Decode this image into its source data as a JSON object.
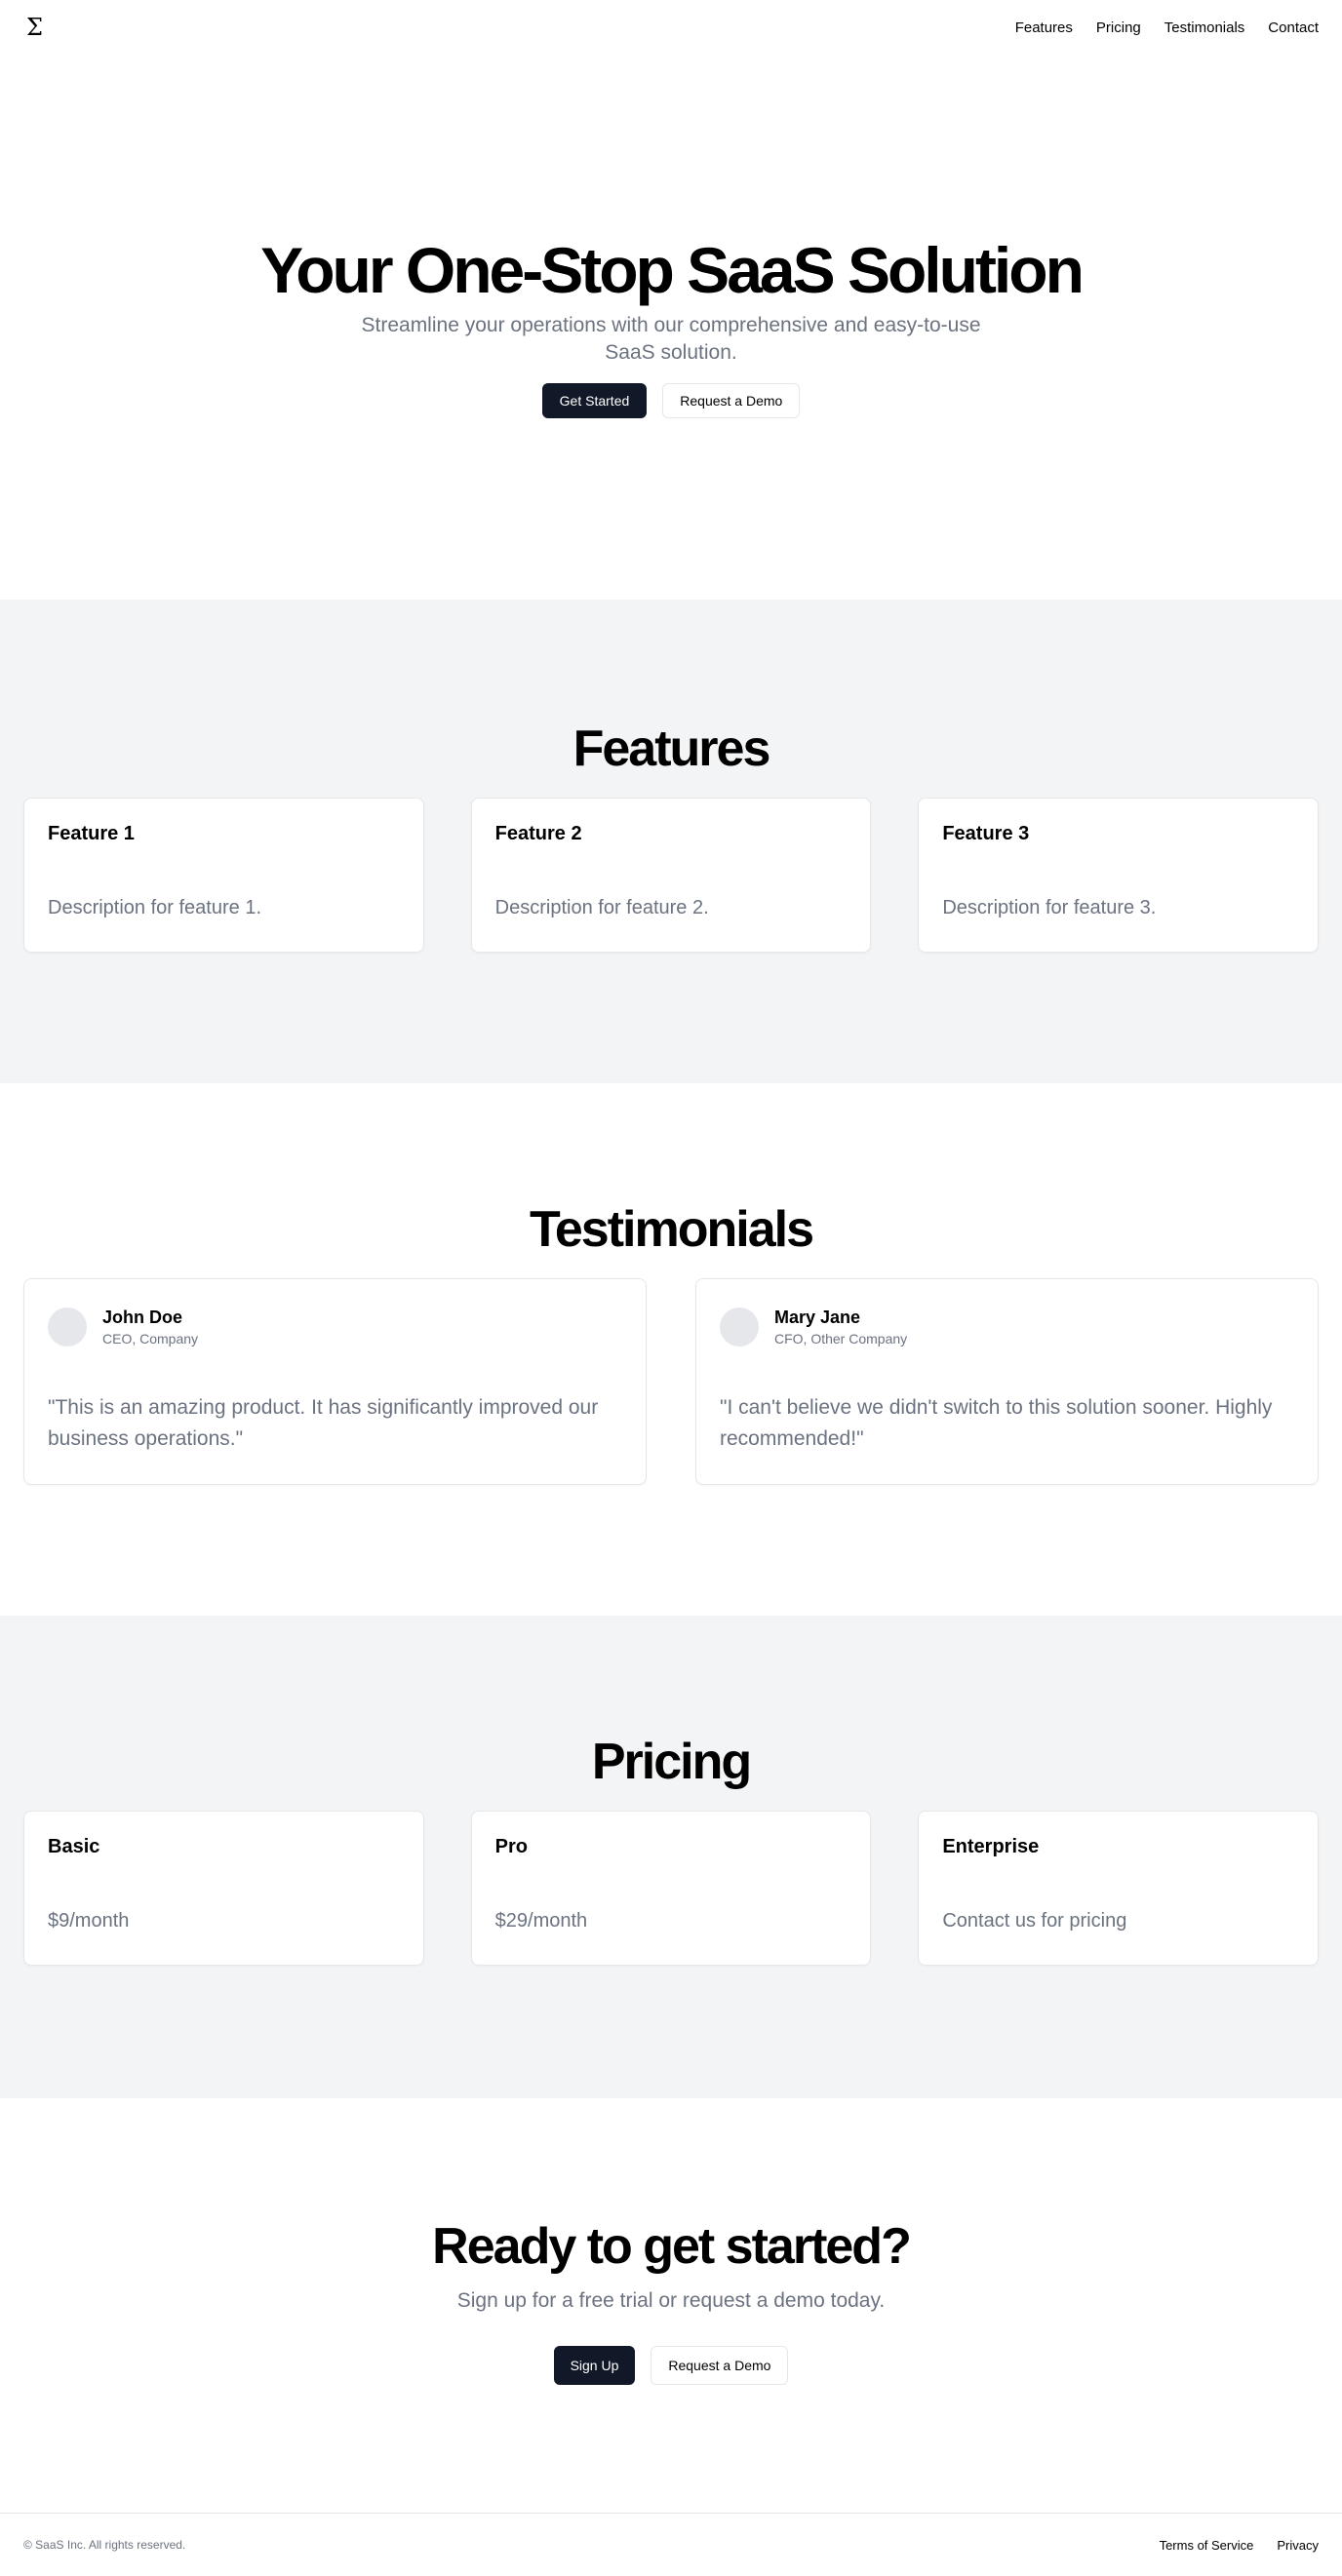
{
  "nav": {
    "logo": "Σ",
    "links": [
      "Features",
      "Pricing",
      "Testimonials",
      "Contact"
    ]
  },
  "hero": {
    "title": "Your One-Stop SaaS Solution",
    "subtitle": "Streamline your operations with our comprehensive and easy-to-use SaaS solution.",
    "primary_button": "Get Started",
    "secondary_button": "Request a Demo"
  },
  "features": {
    "title": "Features",
    "items": [
      {
        "title": "Feature 1",
        "description": "Description for feature 1."
      },
      {
        "title": "Feature 2",
        "description": "Description for feature 2."
      },
      {
        "title": "Feature 3",
        "description": "Description for feature 3."
      }
    ]
  },
  "testimonials": {
    "title": "Testimonials",
    "items": [
      {
        "name": "John Doe",
        "role": "CEO, Company",
        "quote": "\"This is an amazing product. It has significantly improved our business operations.\""
      },
      {
        "name": "Mary Jane",
        "role": "CFO, Other Company",
        "quote": "\"I can't believe we didn't switch to this solution sooner. Highly recommended!\""
      }
    ]
  },
  "pricing": {
    "title": "Pricing",
    "plans": [
      {
        "name": "Basic",
        "price": "$9/month"
      },
      {
        "name": "Pro",
        "price": "$29/month"
      },
      {
        "name": "Enterprise",
        "price": "Contact us for pricing"
      }
    ]
  },
  "cta": {
    "title": "Ready to get started?",
    "subtitle": "Sign up for a free trial or request a demo today.",
    "primary_button": "Sign Up",
    "secondary_button": "Request a Demo"
  },
  "footer": {
    "copyright": "© SaaS Inc. All rights reserved.",
    "links": [
      "Terms of Service",
      "Privacy"
    ]
  },
  "colors": {
    "primary_button": "#111827",
    "muted_text": "#6b7280",
    "gray_section": "#f3f4f6",
    "border": "#e5e7eb"
  }
}
